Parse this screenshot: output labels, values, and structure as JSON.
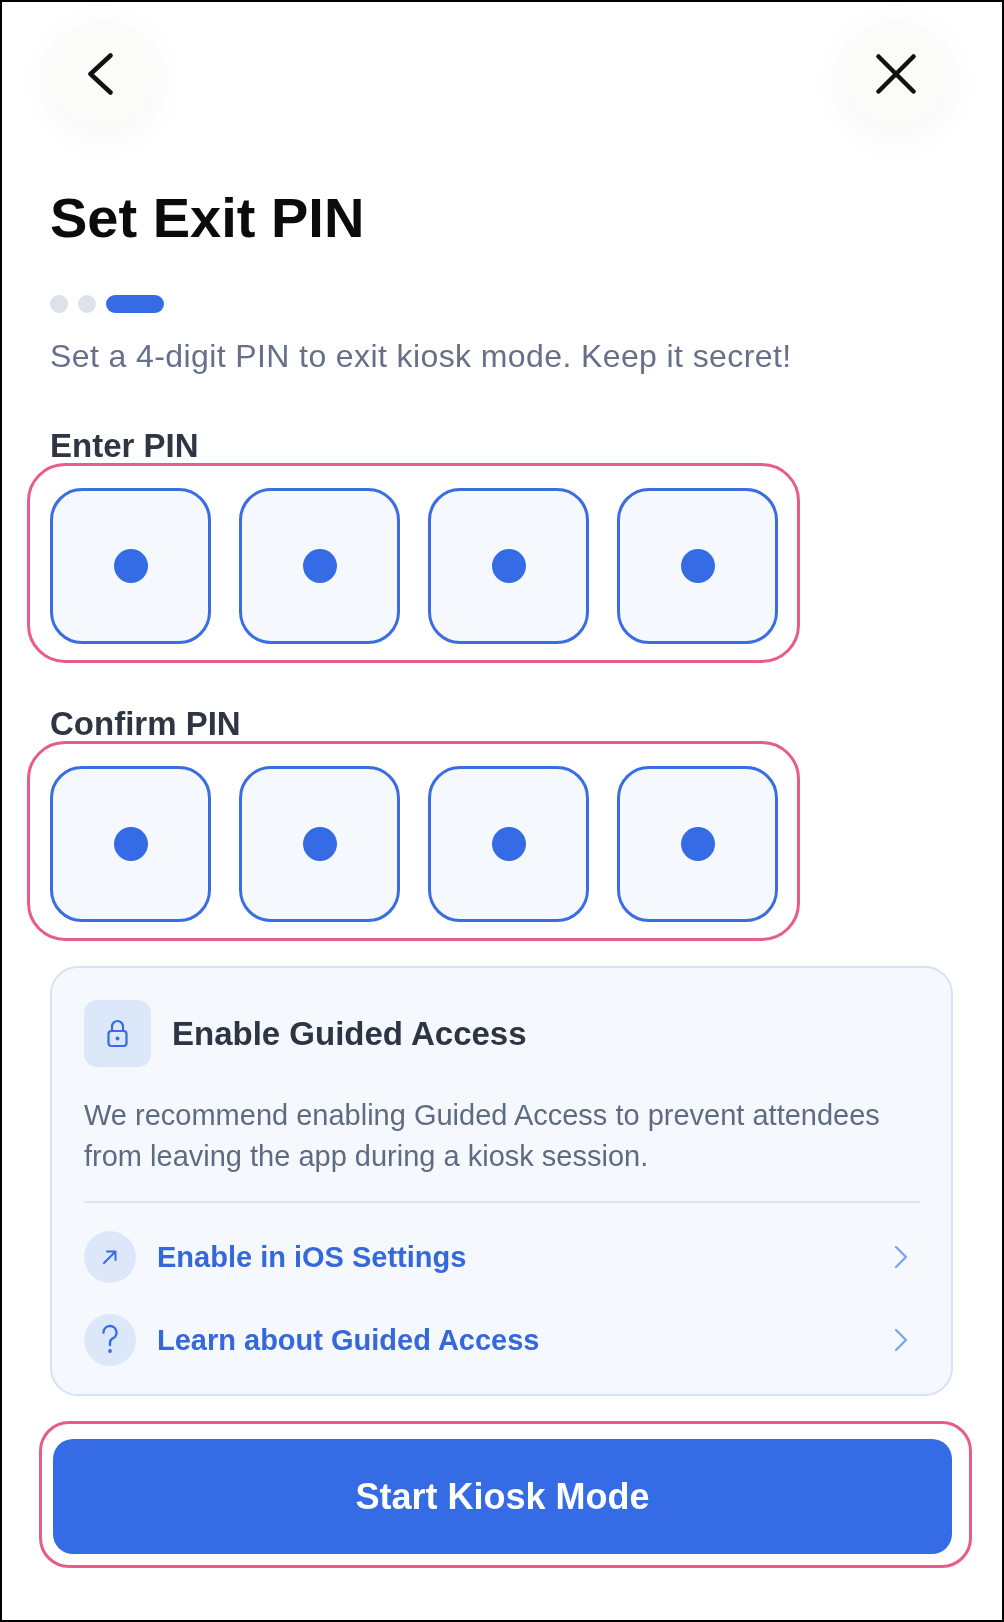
{
  "header": {
    "buttons": [
      {
        "kind": "back"
      },
      {
        "kind": "close"
      }
    ]
  },
  "title": "Set Exit PIN",
  "steps": [
    {
      "selected": false
    },
    {
      "selected": false
    },
    {
      "selected": true
    }
  ],
  "subtitle": "Set a 4-digit PIN to exit kiosk mode. Keep it secret!",
  "pin_groups": [
    {
      "label": "Enter PIN",
      "highlighted": true,
      "digits": [
        {
          "filled": true
        },
        {
          "filled": true
        },
        {
          "filled": true
        },
        {
          "filled": true
        }
      ]
    },
    {
      "label": "Confirm PIN",
      "highlighted": true,
      "digits": [
        {
          "filled": true
        },
        {
          "filled": true
        },
        {
          "filled": true
        },
        {
          "filled": true
        }
      ]
    }
  ],
  "info_card": {
    "title": "Enable Guided Access",
    "description": "We recommend enabling Guided Access to prevent attendees from leaving the app during a kiosk session.",
    "links": [
      {
        "kind": "external",
        "label": "Enable in iOS Settings"
      },
      {
        "kind": "help",
        "label": "Learn about Guided Access"
      }
    ]
  },
  "primary_button": {
    "label": "Start Kiosk Mode",
    "highlighted": true
  }
}
